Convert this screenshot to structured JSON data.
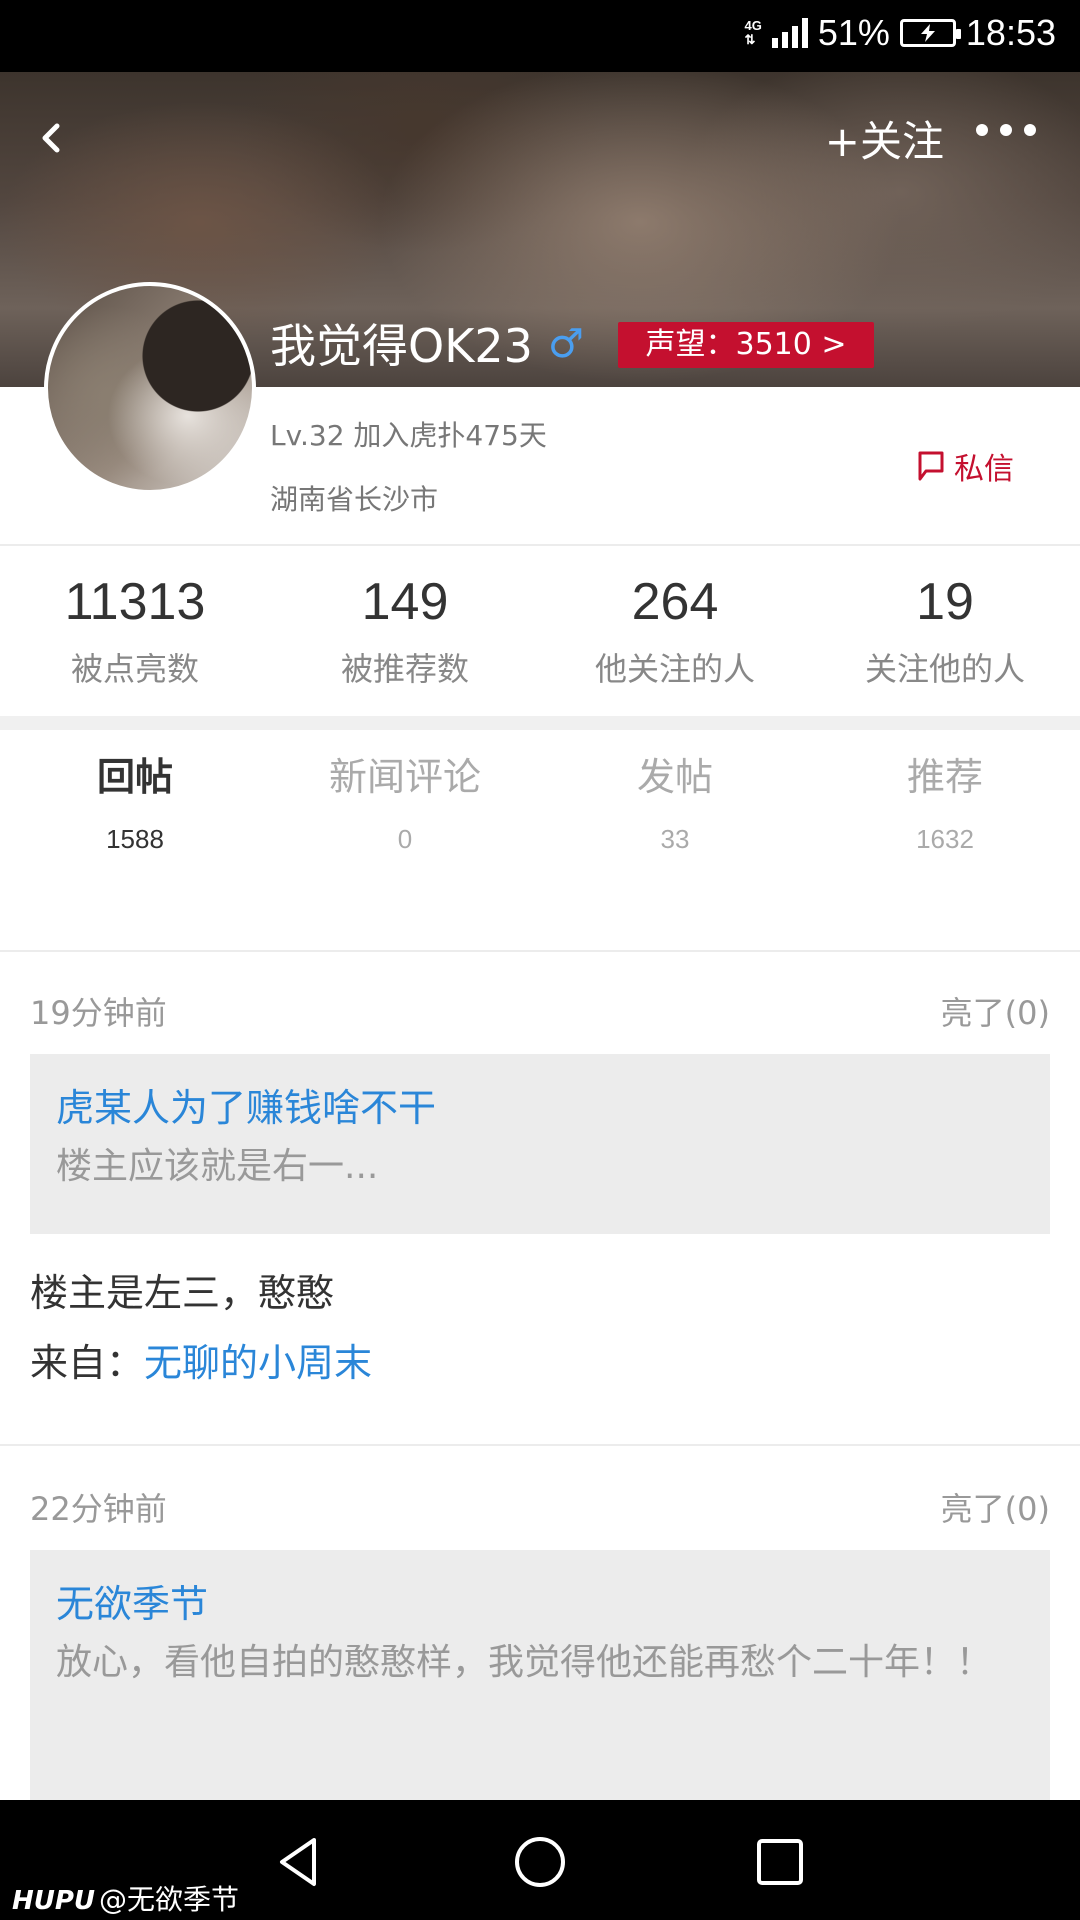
{
  "status_bar": {
    "network": "4G",
    "battery_percent": "51%",
    "time": "18:53"
  },
  "header": {
    "follow_label": "+关注",
    "username": "我觉得OK23",
    "gender_symbol": "♂",
    "reputation_label": "声望：3510 >"
  },
  "profile": {
    "level_info": "Lv.32  加入虎扑475天",
    "location": "湖南省长沙市",
    "message_label": "私信"
  },
  "stats": [
    {
      "value": "11313",
      "label": "被点亮数"
    },
    {
      "value": "149",
      "label": "被推荐数"
    },
    {
      "value": "264",
      "label": "他关注的人"
    },
    {
      "value": "19",
      "label": "关注他的人"
    }
  ],
  "tabs": [
    {
      "label": "回帖",
      "count": "1588"
    },
    {
      "label": "新闻评论",
      "count": "0"
    },
    {
      "label": "发帖",
      "count": "33"
    },
    {
      "label": "推荐",
      "count": "1632"
    }
  ],
  "posts": [
    {
      "time": "19分钟前",
      "likes": "亮了(0)",
      "quote_title": "虎某人为了赚钱啥不干",
      "quote_text": "楼主应该就是右一...",
      "body": "楼主是左三，憨憨",
      "source_prefix": "来自：",
      "source_link": "无聊的小周末"
    },
    {
      "time": "22分钟前",
      "likes": "亮了(0)",
      "quote_title": "无欲季节",
      "quote_text": "放心，看他自拍的憨憨样，我觉得他还能再愁个二十年！！"
    }
  ],
  "watermark": {
    "brand": "HUPU",
    "handle": "@无欲季节"
  },
  "colors": {
    "accent_red": "#c4102f",
    "link_blue": "#2a86d8"
  }
}
